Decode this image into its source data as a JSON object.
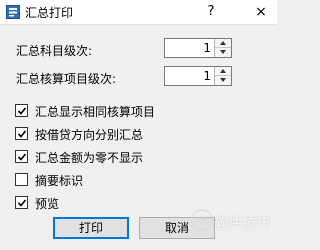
{
  "window": {
    "title": "汇总打印",
    "help_label": "?",
    "close_label": "×"
  },
  "fields": {
    "subject_level": {
      "label": "汇总科目级次:",
      "value": "1"
    },
    "accounting_item_level": {
      "label": "汇总核算项目级次:",
      "value": "1"
    }
  },
  "options": [
    {
      "label": "汇总显示相同核算项目",
      "checked": true
    },
    {
      "label": "按借贷方向分别汇总",
      "checked": true
    },
    {
      "label": "汇总金额为零不显示",
      "checked": true
    },
    {
      "label": "摘要标识",
      "checked": false
    },
    {
      "label": "预览",
      "checked": true
    }
  ],
  "buttons": {
    "print_label": "打印",
    "cancel_label": "取消"
  },
  "watermark": {
    "text": "软件技巧"
  }
}
